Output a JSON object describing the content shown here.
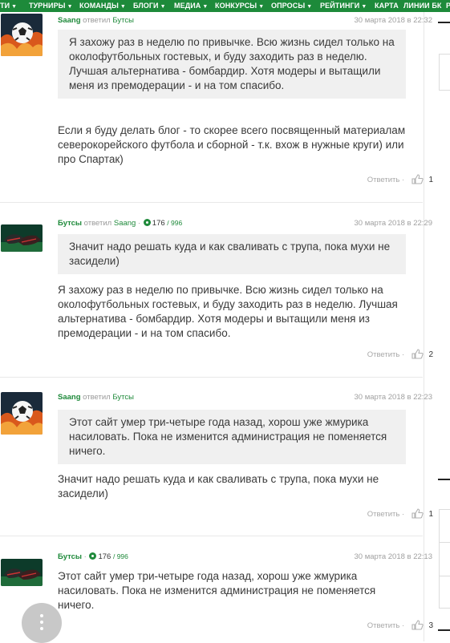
{
  "nav": {
    "items": [
      {
        "label": "ТИ",
        "arrow": "▼"
      },
      {
        "label": "ТУРНИРЫ",
        "arrow": "▼"
      },
      {
        "label": "КОМАНДЫ",
        "arrow": "▼"
      },
      {
        "label": "БЛОГИ",
        "arrow": "▼"
      },
      {
        "label": "МЕДИА",
        "arrow": "▼"
      },
      {
        "label": "КОНКУРСЫ",
        "arrow": "▼"
      },
      {
        "label": "ОПРОСЫ",
        "arrow": "▼"
      },
      {
        "label": "РЕЙТИНГИ",
        "arrow": "▼"
      },
      {
        "label": "КАРТА",
        "arrow": ""
      },
      {
        "label": "ЛИНИИ БК",
        "arrow": ""
      },
      {
        "label": "Р",
        "arrow": ""
      }
    ]
  },
  "comments": [
    {
      "author": "Saang",
      "verb": "ответил",
      "reply_to": "Бутсы",
      "rating": "",
      "rating_max": "",
      "date": "30 марта 2018 в 22:32",
      "quote": "Я захожу раз в неделю по привычке. Всю жизнь сидел только на околофутбольных гостевых, и буду заходить раз в неделю. Лучшая альтернатива - бомбардир. Хотя модеры и вытащили меня из премодерации - и на том спасибо.",
      "text": "Если я буду делать блог - то скорее всего посвященный материалам северокорейского футбола и сборной - т.к. вхож в нужные круги) или про Спартак)",
      "reply_label": "Ответить",
      "likes": "1"
    },
    {
      "author": "Бутсы",
      "verb": "ответил",
      "reply_to": "Saang",
      "rating": "176",
      "rating_max": "/ 996",
      "date": "30 марта 2018 в 22:29",
      "quote": "Значит надо решать куда и как сваливать с трупа, пока мухи не засидели)",
      "text": "Я захожу раз в неделю по привычке. Всю жизнь сидел только на околофутбольных гостевых, и буду заходить раз в неделю. Лучшая альтернатива - бомбардир. Хотя модеры и вытащили меня из премодерации - и на том спасибо.",
      "reply_label": "Ответить",
      "likes": "2"
    },
    {
      "author": "Saang",
      "verb": "ответил",
      "reply_to": "Бутсы",
      "rating": "",
      "rating_max": "",
      "date": "30 марта 2018 в 22:23",
      "quote": "Этот сайт умер три-четыре года назад, хорош уже жмурика насиловать. Пока не изменится администрация не поменяется ничего.",
      "text": "Значит надо решать куда и как сваливать с трупа, пока мухи не засидели)",
      "reply_label": "Ответить",
      "likes": "1"
    },
    {
      "author": "Бутсы",
      "verb": "",
      "reply_to": "",
      "rating": "176",
      "rating_max": "/ 996",
      "date": "30 марта 2018 в 22:13",
      "quote": "",
      "text": "Этот сайт умер три-четыре года назад, хорош уже жмурика насиловать. Пока не изменится администрация не поменяется ничего.",
      "reply_label": "Ответить",
      "likes": "3"
    }
  ],
  "separator": "·",
  "colors": {
    "nav_bg": "#1d8a3a",
    "accent": "#1f8a3b",
    "quote_bg": "#f0f0f0",
    "muted": "#a0a0a0"
  },
  "icons": {
    "like": "thumb-up-icon",
    "more": "more-vertical-icon",
    "avatar_saang": "soccer-ball-fire-avatar",
    "avatar_butsy": "football-boots-avatar"
  }
}
